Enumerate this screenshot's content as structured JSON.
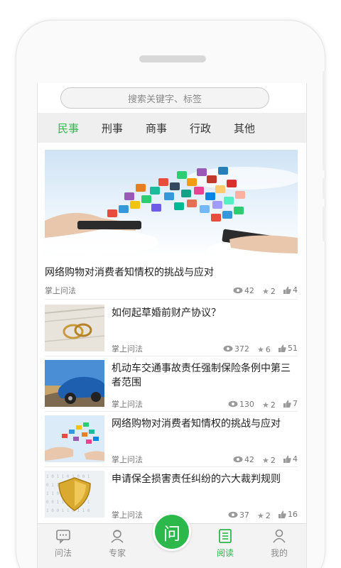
{
  "search": {
    "placeholder": "搜索关键字、标签"
  },
  "tabs": [
    {
      "label": "民事",
      "active": true
    },
    {
      "label": "刑事"
    },
    {
      "label": "商事"
    },
    {
      "label": "行政"
    },
    {
      "label": "其他"
    }
  ],
  "hero": {
    "title": "网络购物对消费者知情权的挑战与应对",
    "source": "掌上问法",
    "views": "42",
    "stars": "2",
    "likes": "4"
  },
  "articles": [
    {
      "title": "如何起草婚前财产协议？",
      "source": "掌上问法",
      "views": "372",
      "stars": "6",
      "likes": "51",
      "thumb_icon": "wedding-rings-image"
    },
    {
      "title": "机动车交通事故责任强制保险条例中第三者范围",
      "source": "掌上问法",
      "views": "130",
      "stars": "2",
      "likes": "7",
      "thumb_icon": "car-image"
    },
    {
      "title": "网络购物对消费者知情权的挑战与应对",
      "source": "掌上问法",
      "views": "42",
      "stars": "2",
      "likes": "4",
      "thumb_icon": "app-icons-image"
    },
    {
      "title": "申请保全损害责任纠纷的六大裁判规则",
      "source": "掌上问法",
      "views": "37",
      "stars": "2",
      "likes": "16",
      "thumb_icon": "shield-image"
    }
  ],
  "nav": {
    "items": [
      {
        "label": "问法",
        "icon": "chat-icon"
      },
      {
        "label": "专家",
        "icon": "expert-icon"
      },
      {
        "label": "阅读",
        "icon": "read-icon",
        "active": true
      },
      {
        "label": "我的",
        "icon": "profile-icon"
      }
    ],
    "center_label": "问"
  },
  "colors": {
    "accent": "#2db84c"
  }
}
